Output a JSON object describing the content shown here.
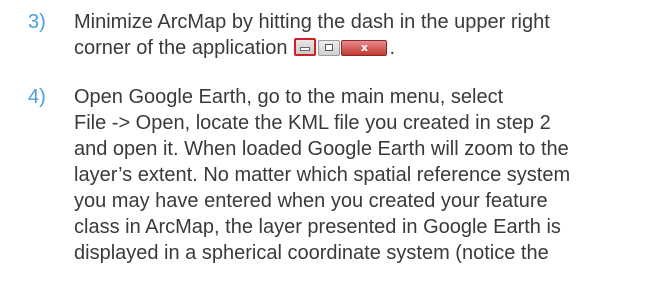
{
  "step3": {
    "number": "3)",
    "line1": "Minimize ArcMap by hitting the dash in the upper right",
    "line2_before": "corner of the application",
    "line2_after": ".",
    "window_controls": {
      "minimize_icon": "minimize-icon",
      "maximize_icon": "maximize-icon",
      "close_icon": "close-icon",
      "close_glyph": "x",
      "highlight_color": "#d31e25"
    }
  },
  "step4": {
    "number": "4)",
    "lines": [
      "Open Google Earth, go to the main menu, select",
      "File -> Open, locate the KML file you created in step 2",
      "and open it. When loaded Google Earth will zoom to the",
      "layer’s extent. No matter which spatial reference system",
      "you may have entered when you created your feature",
      "class in ArcMap, the layer presented in Google Earth is",
      "displayed in a spherical coordinate system (notice the"
    ]
  },
  "colors": {
    "step_number": "#4a9ee0",
    "body_text": "#3a3a3a"
  }
}
